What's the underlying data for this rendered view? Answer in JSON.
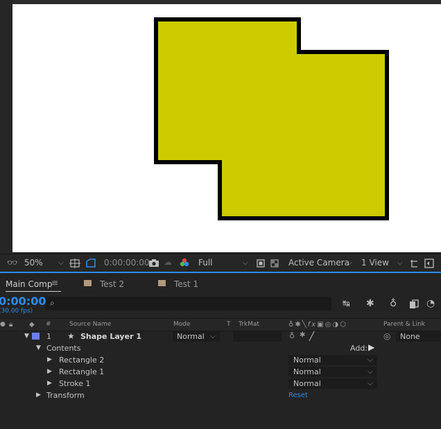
{
  "viewer": {
    "shape_fill": "#cccc00",
    "shape_stroke": "#000000",
    "background": "#ffffff"
  },
  "viewer_toolbar": {
    "magnification": "50%",
    "timecode": "0:00:00:00",
    "resolution": "Full",
    "active_camera": "Active Camera",
    "view_layout": "1 View"
  },
  "tabs": [
    {
      "label": "Main Comp",
      "active": true
    },
    {
      "label": "Test 2",
      "active": false
    },
    {
      "label": "Test 1",
      "active": false
    }
  ],
  "timeline": {
    "timecode": "0:00:00",
    "fps": "(30.00 fps)",
    "search_placeholder": "",
    "columns": {
      "hash": "#",
      "source_name": "Source Name",
      "mode": "Mode",
      "t": "T",
      "trkmat": "TrkMat",
      "parent_link": "Parent & Link"
    },
    "layer": {
      "number": "1",
      "name": "Shape Layer 1",
      "mode": "Normal",
      "parent": "None",
      "label_color": "#6b7ef0"
    },
    "contents_label": "Contents",
    "add_label": "Add:",
    "children": [
      {
        "name": "Rectangle 2",
        "mode": "Normal"
      },
      {
        "name": "Rectangle 1",
        "mode": "Normal"
      },
      {
        "name": "Stroke 1",
        "mode": "Normal"
      }
    ],
    "transform_label": "Transform",
    "reset_label": "Reset"
  }
}
